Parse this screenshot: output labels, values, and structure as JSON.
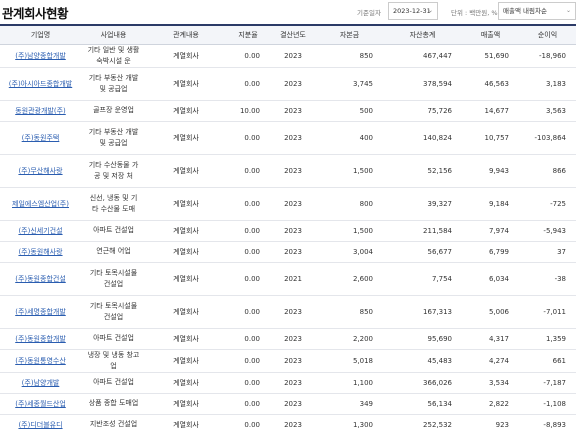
{
  "header": {
    "title": "관계회사현황",
    "base_date_label": "기준일자",
    "base_date": "2023-12-31",
    "unit_label": "단위 : 백만원, %",
    "sort": "매출액 내림차순"
  },
  "table": {
    "columns": [
      "기업명",
      "사업내용",
      "관계내용",
      "지분율",
      "결산년도",
      "자본금",
      "자산총계",
      "매출액",
      "순이익"
    ],
    "rows": [
      {
        "name": "(주)남양종합개발",
        "biz": "기타 일반 및 생활 숙박시설 운",
        "rel": "계열회사",
        "share": "0.00",
        "year": "2023",
        "capital": "850",
        "assets": "467,447",
        "sales": "51,690",
        "profit": "-18,960"
      },
      {
        "name": "(주)아시아드종합개발",
        "biz": "기타 부동산 개발 및 공급업",
        "rel": "계열회사",
        "share": "0.00",
        "year": "2023",
        "capital": "3,745",
        "assets": "378,594",
        "sales": "46,563",
        "profit": "3,183"
      },
      {
        "name": "동원관광개발(주)",
        "biz": "골프장 운영업",
        "rel": "계열회사",
        "share": "10.00",
        "year": "2023",
        "capital": "500",
        "assets": "75,726",
        "sales": "14,677",
        "profit": "3,563"
      },
      {
        "name": "(주)동원주택",
        "biz": "기타 부동산 개발 및 공급업",
        "rel": "계열회사",
        "share": "0.00",
        "year": "2023",
        "capital": "400",
        "assets": "140,824",
        "sales": "10,757",
        "profit": "-103,864"
      },
      {
        "name": "(주)무산해사랑",
        "biz": "기타 수산동물 가공 및 저장 처",
        "rel": "계열회사",
        "share": "0.00",
        "year": "2023",
        "capital": "1,500",
        "assets": "52,156",
        "sales": "9,943",
        "profit": "866"
      },
      {
        "name": "제일에스엠산업(주)",
        "biz": "신선, 냉동 및 기타 수산물 도매",
        "rel": "계열회사",
        "share": "0.00",
        "year": "2023",
        "capital": "800",
        "assets": "39,327",
        "sales": "9,184",
        "profit": "-725"
      },
      {
        "name": "(주)신세기건설",
        "biz": "아파트 건설업",
        "rel": "계열회사",
        "share": "0.00",
        "year": "2023",
        "capital": "1,500",
        "assets": "211,584",
        "sales": "7,974",
        "profit": "-5,943"
      },
      {
        "name": "(주)동원해사랑",
        "biz": "연근해 어업",
        "rel": "계열회사",
        "share": "0.00",
        "year": "2023",
        "capital": "3,004",
        "assets": "56,677",
        "sales": "6,799",
        "profit": "37"
      },
      {
        "name": "(주)동원종합건설",
        "biz": "기타 토목시설물 건설업",
        "rel": "계열회사",
        "share": "0.00",
        "year": "2021",
        "capital": "2,600",
        "assets": "7,754",
        "sales": "6,034",
        "profit": "-38"
      },
      {
        "name": "(주)세명종합개발",
        "biz": "기타 토목시설물 건설업",
        "rel": "계열회사",
        "share": "0.00",
        "year": "2023",
        "capital": "850",
        "assets": "167,313",
        "sales": "5,006",
        "profit": "-7,011"
      },
      {
        "name": "(주)동원종합개발",
        "biz": "아파트 건설업",
        "rel": "계열회사",
        "share": "0.00",
        "year": "2023",
        "capital": "2,200",
        "assets": "95,690",
        "sales": "4,317",
        "profit": "1,359"
      },
      {
        "name": "(주)동원통영수산",
        "biz": "냉장 및 냉동 창고업",
        "rel": "계열회사",
        "share": "0.00",
        "year": "2023",
        "capital": "5,018",
        "assets": "45,483",
        "sales": "4,274",
        "profit": "661"
      },
      {
        "name": "(주)남양개발",
        "biz": "아파트 건설업",
        "rel": "계열회사",
        "share": "0.00",
        "year": "2023",
        "capital": "1,100",
        "assets": "366,026",
        "sales": "3,534",
        "profit": "-7,187"
      },
      {
        "name": "(주)세종월드산업",
        "biz": "상품 종합 도매업",
        "rel": "계열회사",
        "share": "0.00",
        "year": "2023",
        "capital": "349",
        "assets": "56,134",
        "sales": "2,822",
        "profit": "-1,108"
      },
      {
        "name": "(주)디더블유디",
        "biz": "지반조성 건설업",
        "rel": "계열회사",
        "share": "0.00",
        "year": "2023",
        "capital": "1,300",
        "assets": "252,532",
        "sales": "923",
        "profit": "-8,893"
      }
    ]
  }
}
